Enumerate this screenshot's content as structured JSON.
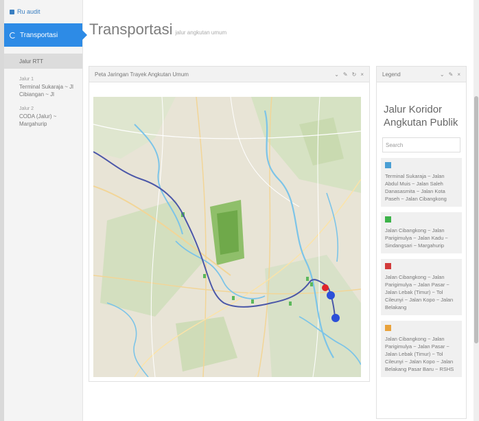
{
  "sidebar": {
    "header": "Ru audit",
    "active_menu": "Transportasi",
    "selected_sub": "Jalur RTT",
    "groups": [
      {
        "title": "Jalur 1",
        "items": [
          "Terminal Sukaraja ~ Jl",
          "Cibiangan ~ Jl"
        ]
      },
      {
        "title": "Jalur 2",
        "items": [
          "CODA (Jalur) ~ Margahurip"
        ]
      }
    ]
  },
  "page": {
    "title": "Transportasi",
    "subtitle": "jalur angkutan umum"
  },
  "map_panel": {
    "title": "Peta Jaringan Trayek Angkutan Umum"
  },
  "legend_panel": {
    "title": "Legend",
    "heading_line1": "Jalur Koridor",
    "heading_line2": "Angkutan Publik",
    "search_placeholder": "Search",
    "items": [
      {
        "color": "#4a9fd4",
        "text": "Terminal Sukaraja ~ Jalan Abdul Muis ~ Jalan Saleh Danasasmita ~ Jalan Kota Paseh ~ Jalan Cibangkong"
      },
      {
        "color": "#3db34a",
        "text": "Jalan Cibangkong ~ Jalan Parigimulya ~ Jalan Kadu ~ Sindangsari ~ Margahurip"
      },
      {
        "color": "#d23a3a",
        "text": "Jalan Cibangkong ~ Jalan Parigimulya ~ Jalan Pasar ~ Jalan Lebak (Timur) ~ Tol Cileunyi ~ Jalan Kopo ~ Jalan Belakang"
      },
      {
        "color": "#e9a23b",
        "text": "Jalan Cibangkong ~ Jalan Parigimulya ~ Jalan Pasar ~ Jalan Lebak (Timur) ~ Tol Cileunyi ~ Jalan Kopo ~ Jalan Belakang Pasar Baru ~ RSHS"
      }
    ]
  },
  "colors": {
    "accent": "#2d8be6",
    "route": "#4b57a8",
    "marker_red": "#e0242a",
    "marker_blue": "#2c4fd8"
  }
}
